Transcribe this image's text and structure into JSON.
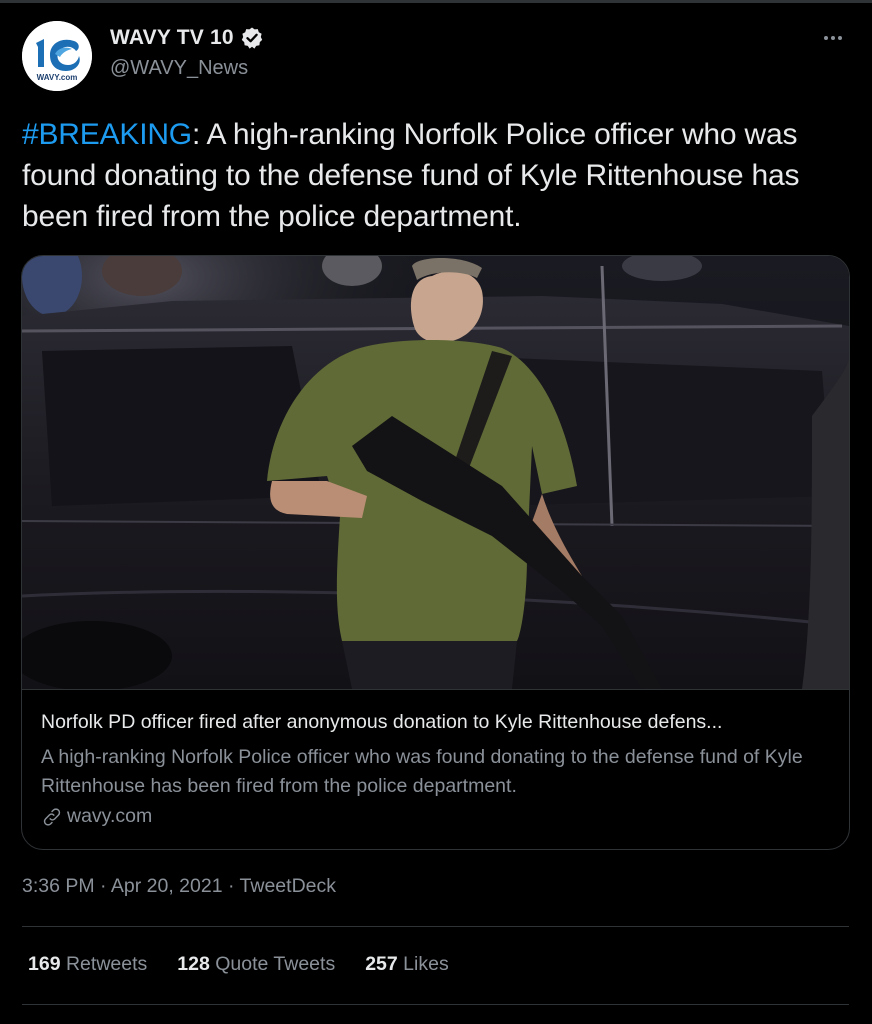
{
  "author": {
    "display_name": "WAVY TV 10",
    "handle": "@WAVY_News",
    "verified": true,
    "avatar_logo_text": "10",
    "avatar_wordmark": "WAVY.com"
  },
  "tweet": {
    "hashtag": "#BREAKING",
    "body": ": A high-ranking Norfolk Police officer who was found donating to the defense fund of Kyle Rittenhouse has been fired from the police department."
  },
  "card": {
    "title": "Norfolk PD officer fired after anonymous donation to Kyle Rittenhouse defens...",
    "description": "A high-ranking Norfolk Police officer who was found donating to the defense fund of Kyle Rittenhouse has been fired from the police department.",
    "domain": "wavy.com",
    "link_icon": "link-icon"
  },
  "meta": {
    "time": "3:36 PM",
    "sep1": " · ",
    "date": "Apr 20, 2021",
    "sep2": " · ",
    "source": "TweetDeck"
  },
  "stats": [
    {
      "count": "169",
      "label": "Retweets"
    },
    {
      "count": "128",
      "label": "Quote Tweets"
    },
    {
      "count": "257",
      "label": "Likes"
    }
  ],
  "colors": {
    "background": "#000000",
    "text": "#e7e9ea",
    "secondary": "#8b9199",
    "link": "#1d9bf0",
    "border": "#2f3336"
  }
}
